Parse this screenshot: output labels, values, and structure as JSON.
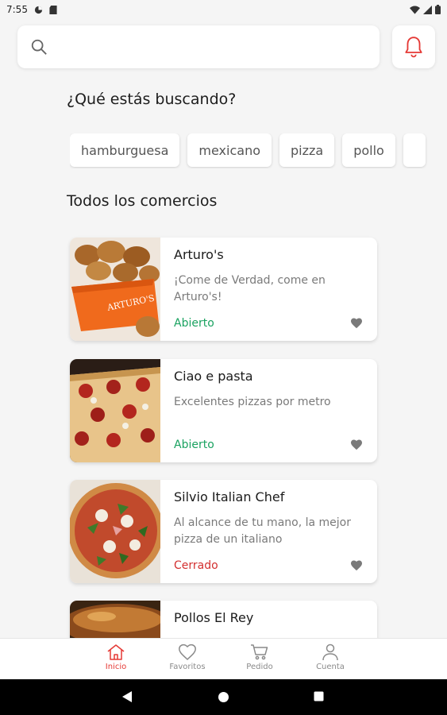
{
  "status_bar": {
    "time": "7:55"
  },
  "search": {
    "placeholder": "",
    "value": ""
  },
  "colors": {
    "accent": "#e53935",
    "open": "#1aa260",
    "closed": "#d32f2f",
    "heart": "#7a7a7a"
  },
  "categories": {
    "title": "¿Qué estás buscando?",
    "chips": [
      "hamburguesa",
      "mexicano",
      "pizza",
      "pollo",
      ""
    ]
  },
  "stores": {
    "title": "Todos los comercios",
    "items": [
      {
        "name": "Arturo's",
        "description": "¡Come de Verdad, come en Arturo's!",
        "status": "Abierto",
        "image_icon": "fried-chicken-box"
      },
      {
        "name": "Ciao e pasta",
        "description": "Excelentes pizzas por metro",
        "status": "Abierto",
        "image_icon": "pepperoni-pizza"
      },
      {
        "name": "Silvio Italian Chef",
        "description": "Al alcance de tu mano, la mejor pizza de un italiano",
        "status": "Cerrado",
        "image_icon": "arugula-pizza"
      },
      {
        "name": "Pollos El Rey",
        "description": "",
        "status": "",
        "image_icon": "roast-chicken"
      }
    ]
  },
  "bottom_nav": {
    "items": [
      {
        "label": "Inicio",
        "icon": "home-icon",
        "active": true
      },
      {
        "label": "Favoritos",
        "icon": "heart-icon",
        "active": false
      },
      {
        "label": "Pedido",
        "icon": "cart-icon",
        "active": false
      },
      {
        "label": "Cuenta",
        "icon": "user-icon",
        "active": false
      }
    ]
  }
}
